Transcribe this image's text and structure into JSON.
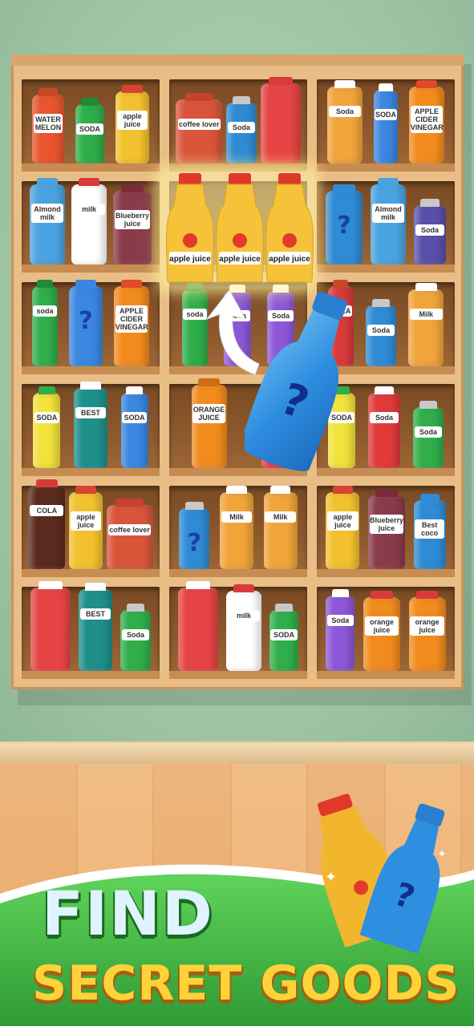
{
  "shelf": {
    "cells": [
      [
        {
          "color": "#e8552e",
          "cap": "#c9482a",
          "label": "WATER MELON",
          "w": 40,
          "h": 86
        },
        {
          "color": "#2fae4a",
          "cap": "#1f8a37",
          "label": "SODA",
          "w": 36,
          "h": 74
        },
        {
          "color": "#f2c12e",
          "cap": "#d94432",
          "label": "apple juice",
          "w": 42,
          "h": 90
        }
      ],
      [
        {
          "color": "#d8553a",
          "cap": "#c7412c",
          "label": "coffee lover",
          "w": 58,
          "h": 80
        },
        {
          "color": "#2e8bd4",
          "cap": "#c8c8c8",
          "label": "Soda",
          "w": 38,
          "h": 76
        },
        {
          "color": "#e64444",
          "cap": "#d93a3a",
          "label": "",
          "w": 50,
          "h": 100
        }
      ],
      [
        {
          "color": "#f0a43a",
          "cap": "#ffffff",
          "label": "Soda",
          "w": 44,
          "h": 96
        },
        {
          "color": "#3a86e0",
          "cap": "#ffffff",
          "label": "SODA",
          "w": 30,
          "h": 92
        },
        {
          "color": "#f28b1e",
          "cap": "#e04a2a",
          "label": "APPLE CIDER VINEGAR",
          "w": 44,
          "h": 96
        }
      ],
      [
        {
          "color": "#4aa3e0",
          "cap": "#4aa3e0",
          "label": "Almond milk",
          "w": 44,
          "h": 100
        },
        {
          "color": "#ffffff",
          "cap": "#d83a3a",
          "label": "milk",
          "w": 44,
          "h": 100
        },
        {
          "color": "#8a3b4a",
          "cap": "#7a2a3a",
          "label": "Blueberry juice",
          "w": 48,
          "h": 92
        }
      ],
      [
        {
          "color": "#f2c12e",
          "cap": "#d94432",
          "label": "apple juice",
          "w": 0,
          "h": 0
        }
      ],
      [
        {
          "color": "#2e8bd4",
          "cap": "#2e8bd4",
          "label": "?",
          "w": 46,
          "h": 92
        },
        {
          "color": "#4aa3e0",
          "cap": "#4aa3e0",
          "label": "Almond milk",
          "w": 44,
          "h": 100
        },
        {
          "color": "#5a4fa8",
          "cap": "#c8c8c8",
          "label": "Soda",
          "w": 40,
          "h": 74
        }
      ],
      [
        {
          "color": "#2fae4a",
          "cap": "#1f8a37",
          "label": "soda",
          "w": 32,
          "h": 100
        },
        {
          "color": "#3a86e0",
          "cap": "#3a86e0",
          "label": "?",
          "w": 42,
          "h": 100
        },
        {
          "color": "#f28b1e",
          "cap": "#e04a2a",
          "label": "APPLE CIDER VINEGAR",
          "w": 44,
          "h": 100
        }
      ],
      [
        {
          "color": "#2fae4a",
          "cap": "#1f8a37",
          "label": "soda",
          "w": 32,
          "h": 96
        },
        {
          "color": "#8d57d8",
          "cap": "#ffffff",
          "label": "Soda",
          "w": 34,
          "h": 94
        },
        {
          "color": "#8d57d8",
          "cap": "#ffffff",
          "label": "Soda",
          "w": 34,
          "h": 94
        }
      ],
      [
        {
          "color": "#d83a3a",
          "cap": "#c9482a",
          "label": "COLA",
          "w": 32,
          "h": 100
        },
        {
          "color": "#2e8bd4",
          "cap": "#c8c8c8",
          "label": "Soda",
          "w": 38,
          "h": 76
        },
        {
          "color": "#f0a43a",
          "cap": "#ffffff",
          "label": "Milk",
          "w": 44,
          "h": 96
        }
      ],
      [
        {
          "color": "#f2e23a",
          "cap": "#2fae4a",
          "label": "SODA",
          "w": 34,
          "h": 94
        },
        {
          "color": "#1e8f8a",
          "cap": "#ffffff",
          "label": "BEST",
          "w": 42,
          "h": 100
        },
        {
          "color": "#3a86e0",
          "cap": "#ffffff",
          "label": "SODA",
          "w": 34,
          "h": 94
        }
      ],
      [
        {
          "color": "#f28b1e",
          "cap": "#d06d12",
          "label": "ORANGE JUICE",
          "w": 44,
          "h": 104
        },
        {
          "color": "#e83a4a",
          "cap": "#e83a4a",
          "label": "soda",
          "w": 30,
          "h": 92
        }
      ],
      [
        {
          "color": "#f2e23a",
          "cap": "#2fae4a",
          "label": "SODA",
          "w": 34,
          "h": 94
        },
        {
          "color": "#e03a3a",
          "cap": "#ffffff",
          "label": "Soda",
          "w": 40,
          "h": 94
        },
        {
          "color": "#2fae4a",
          "cap": "#c8c8c8",
          "label": "Soda",
          "w": 38,
          "h": 76
        }
      ],
      [
        {
          "color": "#5a2a1e",
          "cap": "#d83a3a",
          "label": "COLA",
          "w": 46,
          "h": 104
        },
        {
          "color": "#f2c12e",
          "cap": "#d94432",
          "label": "apple juice",
          "w": 42,
          "h": 96
        },
        {
          "color": "#d8553a",
          "cap": "#c7412c",
          "label": "coffee lover",
          "w": 58,
          "h": 80
        }
      ],
      [
        {
          "color": "#2e8bd4",
          "cap": "#c8c8c8",
          "label": "?",
          "w": 38,
          "h": 76
        },
        {
          "color": "#f0a43a",
          "cap": "#ffffff",
          "label": "Milk",
          "w": 42,
          "h": 96
        },
        {
          "color": "#f0a43a",
          "cap": "#ffffff",
          "label": "Milk",
          "w": 42,
          "h": 96
        }
      ],
      [
        {
          "color": "#f2c12e",
          "cap": "#d94432",
          "label": "apple juice",
          "w": 42,
          "h": 96
        },
        {
          "color": "#8a3b4a",
          "cap": "#7a2a3a",
          "label": "Blueberry juice",
          "w": 46,
          "h": 92
        },
        {
          "color": "#2e8bd4",
          "cap": "#2e8bd4",
          "label": "Best coco",
          "w": 40,
          "h": 86
        }
      ],
      [
        {
          "color": "#e64444",
          "cap": "#ffffff",
          "label": "",
          "w": 50,
          "h": 104
        },
        {
          "color": "#1e8f8a",
          "cap": "#ffffff",
          "label": "BEST",
          "w": 42,
          "h": 102
        },
        {
          "color": "#2fae4a",
          "cap": "#c8c8c8",
          "label": "Soda",
          "w": 38,
          "h": 76
        }
      ],
      [
        {
          "color": "#e64444",
          "cap": "#ffffff",
          "label": "",
          "w": 50,
          "h": 104
        },
        {
          "color": "#ffffff",
          "cap": "#d83a3a",
          "label": "milk",
          "w": 44,
          "h": 100
        },
        {
          "color": "#2fae4a",
          "cap": "#c8c8c8",
          "label": "SODA",
          "w": 36,
          "h": 76
        }
      ],
      [
        {
          "color": "#8d57d8",
          "cap": "#ffffff",
          "label": "Soda",
          "w": 36,
          "h": 94
        },
        {
          "color": "#f28b1e",
          "cap": "#d83a3a",
          "label": "orange juice",
          "w": 46,
          "h": 92
        },
        {
          "color": "#f28b1e",
          "cap": "#d83a3a",
          "label": "orange juice",
          "w": 46,
          "h": 92
        }
      ]
    ]
  },
  "highlight": {
    "label": "apple juice"
  },
  "held_item": {
    "label": "?"
  },
  "banner": {
    "line1": "FIND",
    "line2": "SECRET GOODS"
  }
}
